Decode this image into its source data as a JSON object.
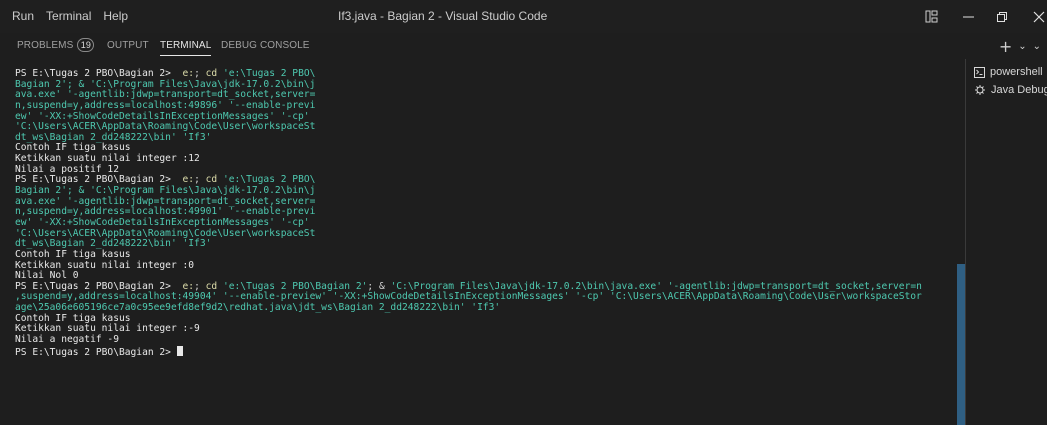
{
  "menu": [
    "Run",
    "Terminal",
    "Help"
  ],
  "window_title": "If3.java - Bagian 2 - Visual Studio Code",
  "panel": {
    "tabs": [
      {
        "label": "PROBLEMS",
        "badge": "19"
      },
      {
        "label": "OUTPUT"
      },
      {
        "label": "TERMINAL",
        "active": true
      },
      {
        "label": "DEBUG CONSOLE"
      }
    ],
    "actions": [
      "+",
      "⌄",
      "⌄"
    ]
  },
  "terminals": [
    {
      "icon": "powershell-icon",
      "label": "powershell"
    },
    {
      "icon": "java-debug-icon",
      "label": "Java Debug"
    }
  ],
  "terminal_lines": [
    "PS E:\\Tugas 2 PBO\\Bagian 2>  e:; cd 'e:\\Tugas 2 PBO\\",
    "Bagian 2'; & 'C:\\Program Files\\Java\\jdk-17.0.2\\bin\\j",
    "ava.exe' '-agentlib:jdwp=transport=dt_socket,server=",
    "n,suspend=y,address=localhost:49896' '--enable-previ",
    "ew' '-XX:+ShowCodeDetailsInExceptionMessages' '-cp'",
    "'C:\\Users\\ACER\\AppData\\Roaming\\Code\\User\\workspaceSt",
    "dt_ws\\Bagian 2_dd248222\\bin' 'If3'",
    "Contoh IF tiga kasus",
    "Ketikkan suatu nilai integer :12",
    "Nilai a positif 12",
    "PS E:\\Tugas 2 PBO\\Bagian 2>  e:; cd 'e:\\Tugas 2 PBO\\",
    "Bagian 2'; & 'C:\\Program Files\\Java\\jdk-17.0.2\\bin\\j",
    "ava.exe' '-agentlib:jdwp=transport=dt_socket,server=",
    "n,suspend=y,address=localhost:49901' '--enable-previ",
    "ew' '-XX:+ShowCodeDetailsInExceptionMessages' '-cp'",
    "'C:\\Users\\ACER\\AppData\\Roaming\\Code\\User\\workspaceSt",
    "dt_ws\\Bagian 2_dd248222\\bin' 'If3'",
    "Contoh IF tiga kasus",
    "Ketikkan suatu nilai integer :0",
    "Nilai Nol 0",
    "PS E:\\Tugas 2 PBO\\Bagian 2>  e:; cd 'e:\\Tugas 2 PBO\\Bagian 2'; & 'C:\\Program Files\\Java\\jdk-17.0.2\\bin\\java.exe' '-agentlib:jdwp=transport=dt_socket,server=n",
    ",suspend=y,address=localhost:49904' '--enable-preview' '-XX:+ShowCodeDetailsInExceptionMessages' '-cp' 'C:\\Users\\ACER\\AppData\\Roaming\\Code\\User\\workspaceStor",
    "age\\25a06e605196ce7a0c95ee9efd8ef9d2\\redhat.java\\jdt_ws\\Bagian 2_dd248222\\bin' 'If3'",
    "Contoh IF tiga kasus",
    "Ketikkan suatu nilai integer :-9",
    "Nilai a negatif -9",
    "PS E:\\Tugas 2 PBO\\Bagian 2> "
  ],
  "colors": {
    "background": "#1e1e1e",
    "titlebar": "#1f1f1f",
    "command": "#dcdcaa",
    "argument": "#4ec9b0",
    "string": "#ce9178",
    "scroll_thumb": "#2f5f83"
  }
}
